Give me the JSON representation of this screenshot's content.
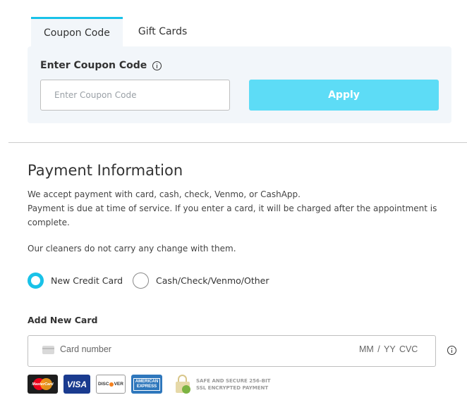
{
  "tabs": [
    {
      "label": "Coupon Code",
      "active": true
    },
    {
      "label": "Gift Cards",
      "active": false
    }
  ],
  "coupon": {
    "heading": "Enter Coupon Code",
    "info_icon": "info-circle-icon",
    "input_placeholder": "Enter Coupon Code",
    "input_value": "",
    "apply_label": "Apply"
  },
  "payment": {
    "title": "Payment Information",
    "line1": "We accept payment with card, cash, check, Venmo, or CashApp.",
    "line2": "Payment is due at time of service. If you enter a card, it will be charged after the appointment is complete.",
    "cleaners_note": "Our cleaners do not carry any change with them.",
    "options": [
      {
        "label": "New Credit Card",
        "selected": true
      },
      {
        "label": "Cash/Check/Venmo/Other",
        "selected": false
      }
    ],
    "add_card_label": "Add New Card",
    "card_number_placeholder": "Card number",
    "card_exp_placeholder": "MM / YY  CVC",
    "card_logos": {
      "mastercard": "MasterCard",
      "visa": "VISA",
      "discover": "DISC",
      "discover_end": "VER",
      "amex_line1": "AMERICAN",
      "amex_line2": "EXPRESS"
    },
    "secure_line1": "SAFE AND SECURE 256-BIT",
    "secure_line2": "SSL ENCRYPTED PAYMENT"
  },
  "colors": {
    "accent": "#19c2e8",
    "apply_button": "#5ddcf6",
    "panel_bg": "#f2f6fa"
  }
}
